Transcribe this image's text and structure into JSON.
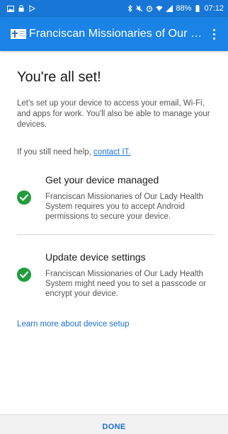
{
  "status_bar": {
    "battery": "88%",
    "time": "07:12",
    "left_icons": [
      "gallery-icon",
      "lock-icon",
      "play-icon"
    ],
    "right_icons": [
      "bluetooth-icon",
      "mute-icon",
      "alarm-icon",
      "wifi-icon",
      "signal-icon",
      "battery-icon"
    ]
  },
  "app_bar": {
    "title": "Franciscan Missionaries of Our L...",
    "logo_icon": "organization-logo",
    "menu_icon": "overflow-menu-icon",
    "color": "#1b82e6"
  },
  "main": {
    "heading": "You're all set!",
    "intro": "Let's set up your device to access your email, Wi-Fi, and apps for work. You'll also be able to manage your devices.",
    "help_prefix": "If you still need help, ",
    "help_link": "contact IT.",
    "steps": [
      {
        "title": "Get your device managed",
        "description": "Franciscan Missionaries of Our Lady Health System requires you to accept Android permissions to secure your device.",
        "status_icon": "check-circle-icon"
      },
      {
        "title": "Update device settings",
        "description": "Franciscan Missionaries of Our Lady Health System might need you to set a passcode or encrypt your device.",
        "status_icon": "check-circle-icon"
      }
    ],
    "learn_more": "Learn more about device setup"
  },
  "footer": {
    "done_label": "DONE"
  },
  "colors": {
    "accent": "#1b6fd3",
    "success": "#1f9e3b",
    "status_bar": "#1877d6"
  }
}
